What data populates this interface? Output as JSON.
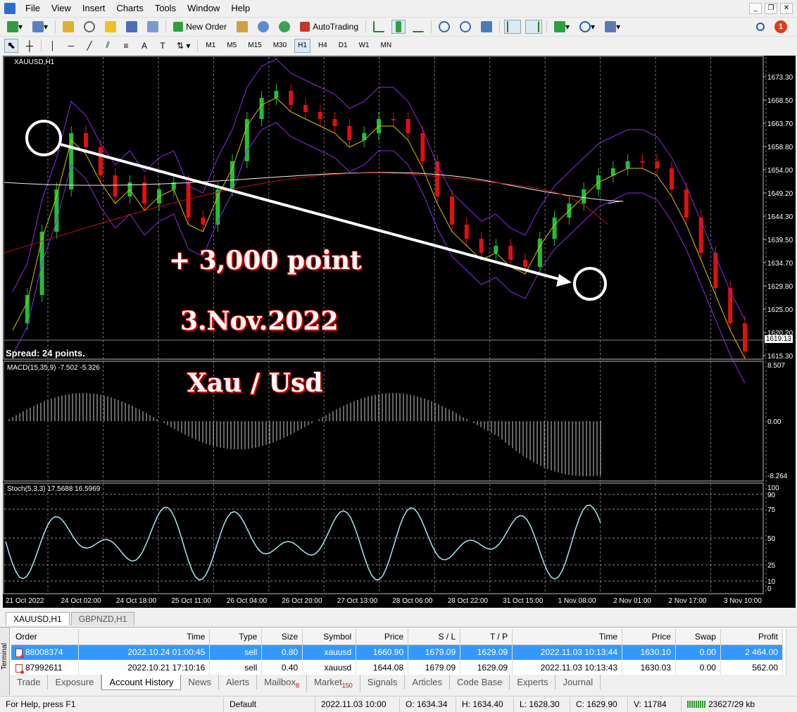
{
  "menu": [
    "File",
    "View",
    "Insert",
    "Charts",
    "Tools",
    "Window",
    "Help"
  ],
  "toolbar": {
    "new_order_label": "New Order",
    "autotrading_label": "AutoTrading",
    "timeframes": [
      "M1",
      "M5",
      "M15",
      "M30",
      "H1",
      "H4",
      "D1",
      "W1",
      "MN"
    ],
    "active_timeframe": "H1",
    "notification_count": "1"
  },
  "chart": {
    "symbol_label": "XAUUSD,H1",
    "spread_label": "Spread: 24 points.",
    "annotation_points": "+ 3,000 point",
    "annotation_date": "3.Nov.2022",
    "annotation_pair": "Xau / Usd",
    "current_price": "1619.13",
    "price_ticks": [
      "1673.30",
      "1668.50",
      "1663.70",
      "1658.80",
      "1654.00",
      "1649.20",
      "1644.30",
      "1639.50",
      "1634.70",
      "1629.80",
      "1625.00",
      "1620.20",
      "1615.30"
    ],
    "time_ticks": [
      "21 Oct 2022",
      "24 Oct 02:00",
      "24 Oct 18:00",
      "25 Oct 11:00",
      "26 Oct 04:00",
      "26 Oct 20:00",
      "27 Oct 13:00",
      "28 Oct 06:00",
      "28 Oct 22:00",
      "31 Oct 15:00",
      "1 Nov 08:00",
      "2 Nov 01:00",
      "2 Nov 17:00",
      "3 Nov 10:00"
    ],
    "macd_label": "MACD(15,35,9) -7.502 -5.326",
    "macd_ticks": [
      "8.507",
      "0.00",
      "-8.264"
    ],
    "stoch_label": "Stoch(5,3,3) 17.5688 16.5969",
    "stoch_ticks": [
      "100",
      "90",
      "75",
      "50",
      "25",
      "10",
      "0"
    ]
  },
  "chart_tabs": [
    "XAUUSD,H1",
    "GBPNZD,H1"
  ],
  "terminal": {
    "side_label": "Terminal",
    "columns": [
      "Order",
      "Time",
      "Type",
      "Size",
      "Symbol",
      "Price",
      "S / L",
      "T / P",
      "Time",
      "Price",
      "Swap",
      "Profit"
    ],
    "rows": [
      [
        "88008374",
        "2022.10.24 01:00:45",
        "sell",
        "0.80",
        "xauusd",
        "1660.90",
        "1679.09",
        "1629.09",
        "2022.11.03 10:13:44",
        "1630.10",
        "0.00",
        "2 464.00"
      ],
      [
        "87992611",
        "2022.10.21 17:10:16",
        "sell",
        "0.40",
        "xauusd",
        "1644.08",
        "1679.09",
        "1629.09",
        "2022.11.03 10:13:43",
        "1630.03",
        "0.00",
        "562.00"
      ]
    ],
    "tabs": [
      "Trade",
      "Exposure",
      "Account History",
      "News",
      "Alerts",
      "Mailbox",
      "Market",
      "Signals",
      "Articles",
      "Code Base",
      "Experts",
      "Journal"
    ],
    "mailbox_badge": "8",
    "market_badge": "150",
    "active_tab": "Account History"
  },
  "status": {
    "help": "For Help, press F1",
    "profile": "Default",
    "datetime": "2022.11.03 10:00",
    "open": "O: 1634.34",
    "high": "H: 1634.40",
    "low": "L: 1628.30",
    "close": "C: 1629.90",
    "volume": "V: 11784",
    "traffic": "23627/29 kb"
  }
}
